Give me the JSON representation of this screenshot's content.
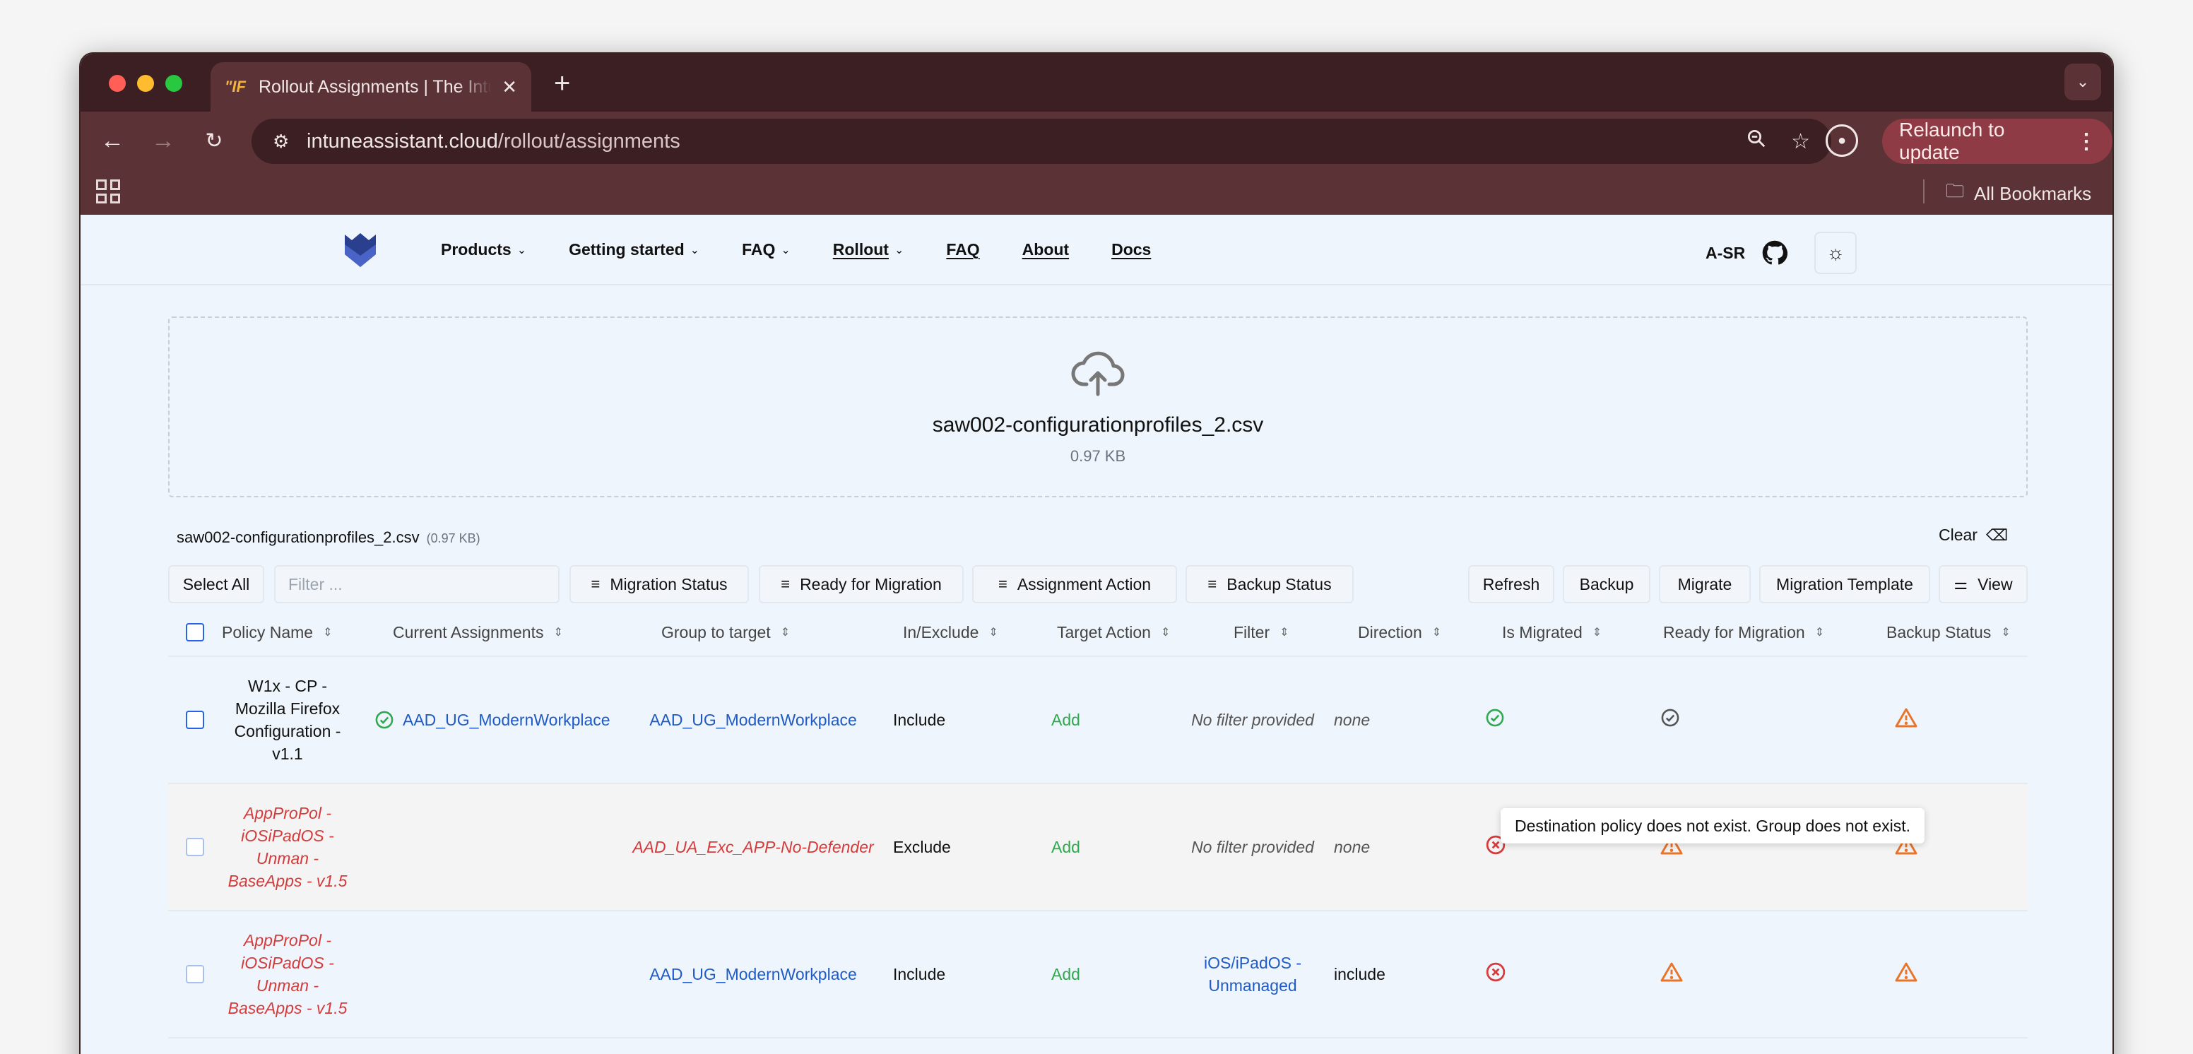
{
  "browser": {
    "tab_title": "Rollout Assignments | The Intune Assistant",
    "favicon_text": "\"IF",
    "url_host": "intuneassistant.cloud",
    "url_path": "/rollout/assignments",
    "relaunch_label": "Relaunch to update",
    "all_bookmarks_label": "All Bookmarks"
  },
  "header": {
    "nav": [
      {
        "label": "Products"
      },
      {
        "label": "Getting started"
      },
      {
        "label": "FAQ"
      },
      {
        "label": "Rollout"
      },
      {
        "label": "FAQ"
      },
      {
        "label": "About"
      },
      {
        "label": "Docs"
      }
    ],
    "user_initials": "A-SR"
  },
  "upload": {
    "file_name": "saw002-configurationprofiles_2.csv",
    "file_size": "0.97 KB",
    "file_size_paren": "(0.97 KB)",
    "clear_label": "Clear"
  },
  "controls": {
    "select_all": "Select All",
    "filter_placeholder": "Filter ...",
    "filters": [
      "Migration Status",
      "Ready for Migration",
      "Assignment Action",
      "Backup Status"
    ],
    "actions": [
      "Refresh",
      "Backup",
      "Migrate",
      "Migration Template"
    ],
    "view_label": "View"
  },
  "table": {
    "columns": [
      "Policy Name",
      "Current Assignments",
      "Group to target",
      "In/Exclude",
      "Target Action",
      "Filter",
      "Direction",
      "Is Migrated",
      "Ready for Migration",
      "Backup Status"
    ],
    "rows": [
      {
        "policy_name": "W1x - CP - Mozilla Firefox Configuration - v1.1",
        "current_assignment": "AAD_UG_ModernWorkplace",
        "group_to_target": "AAD_UG_ModernWorkplace",
        "in_exclude": "Include",
        "target_action": "Add",
        "filter": "No filter provided",
        "direction": "none",
        "is_migrated": "migrated-check",
        "ready": "ready-check",
        "backup": "warning"
      },
      {
        "policy_name": "AppProPol - iOSiPadOS - Unman - BaseApps - v1.5",
        "current_assignment": "",
        "group_to_target": "AAD_UA_Exc_APP-No-Defender",
        "in_exclude": "Exclude",
        "target_action": "Add",
        "filter": "No filter provided",
        "direction": "none",
        "is_migrated": "error",
        "ready": "warning",
        "backup": "warning"
      },
      {
        "policy_name": "AppProPol - iOSiPadOS - Unman - BaseApps - v1.5",
        "current_assignment": "",
        "group_to_target": "AAD_UG_ModernWorkplace",
        "in_exclude": "Include",
        "target_action": "Add",
        "filter": "iOS/iPadOS - Unmanaged",
        "direction": "include",
        "is_migrated": "error",
        "ready": "warning",
        "backup": "warning"
      }
    ]
  },
  "tooltip": "Destination policy does not exist. Group does not exist.",
  "colors": {
    "accent_blue": "#1f5bc6",
    "success_green": "#2fa84f",
    "error_red": "#d63a3a",
    "warning_orange": "#e8742a",
    "relaunch_bg": "#8e3b45"
  }
}
